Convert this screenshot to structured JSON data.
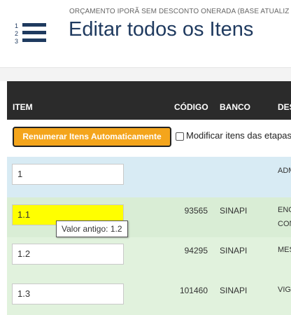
{
  "header": {
    "subtitle": "ORÇAMENTO IPORÃ SEM DESCONTO ONERADA (BASE ATUALIZ",
    "title": "Editar todos os Itens",
    "icon": "numbered-list-icon",
    "icon_numbers": [
      "1",
      "2",
      "3"
    ],
    "title_color": "#1f3a5f"
  },
  "table": {
    "columns": [
      "ITEM",
      "CÓDIGO",
      "BANCO",
      "DES"
    ],
    "renumber_label": "Renumerar Itens Automaticamente",
    "modify_label": "Modificar itens das etapas",
    "modify_checked": false,
    "rows": [
      {
        "item": "1",
        "codigo": "",
        "banco": "",
        "desc": [
          "ADM"
        ],
        "changed": false
      },
      {
        "item": "1.1",
        "codigo": "93565",
        "banco": "SINAPI",
        "desc": [
          "ENG",
          "CON"
        ],
        "changed": true
      },
      {
        "item": "1.2",
        "codigo": "94295",
        "banco": "SINAPI",
        "desc": [
          "MES"
        ],
        "changed": false
      },
      {
        "item": "1.3",
        "codigo": "101460",
        "banco": "SINAPI",
        "desc": [
          "VIG"
        ],
        "changed": false
      }
    ]
  },
  "tooltip": {
    "text": "Valor antigo: 1.2"
  },
  "colors": {
    "header_bg": "#2b2b2b",
    "button_bg": "#f4a51c",
    "changed_highlight": "#ffff00",
    "row_blue": "#d8ebf4",
    "row_green": "#d9edd5"
  }
}
